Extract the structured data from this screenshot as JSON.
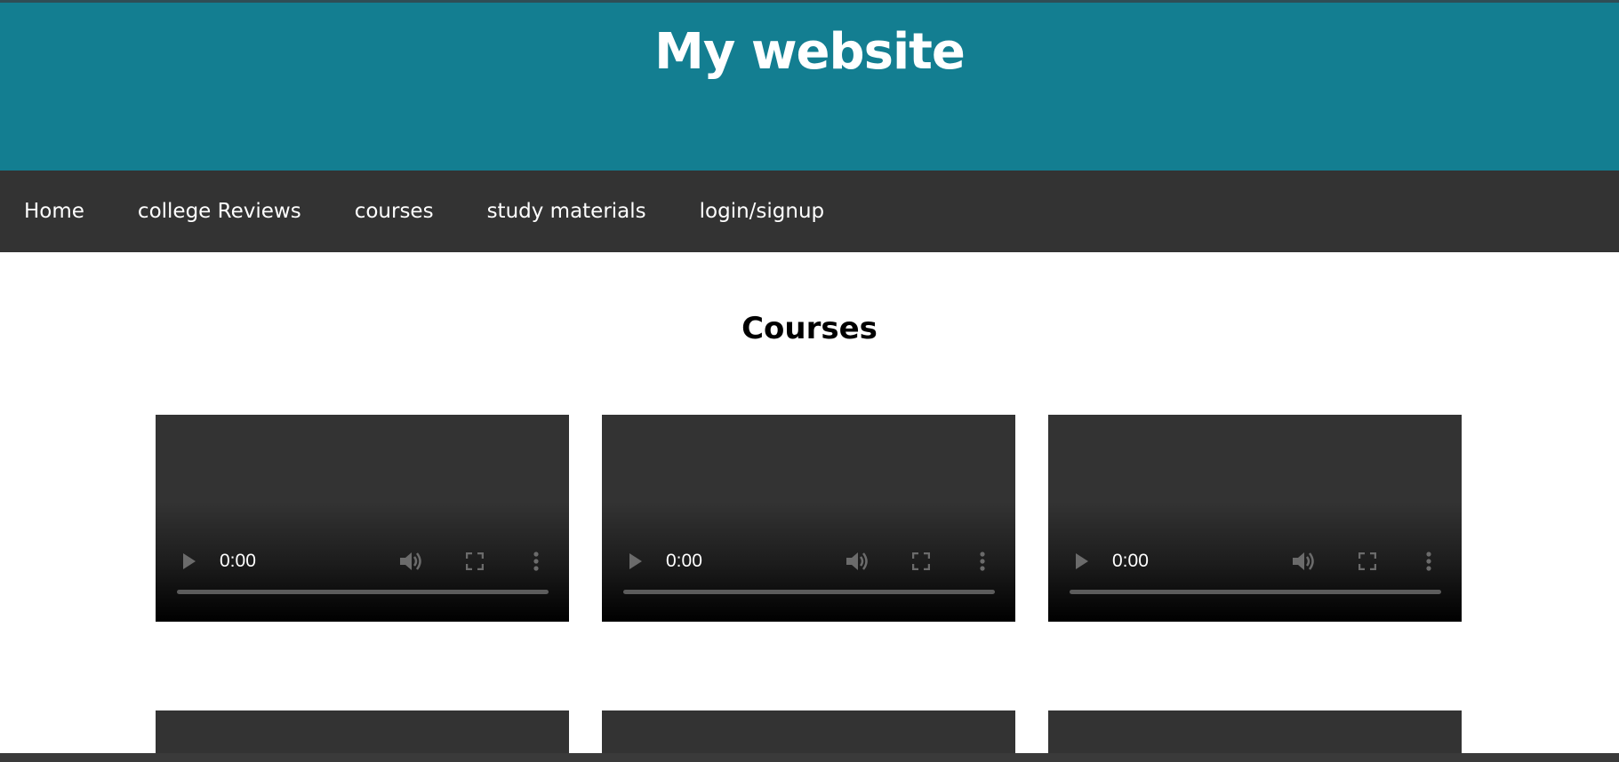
{
  "header": {
    "title": "My website"
  },
  "nav": {
    "items": [
      {
        "label": "Home"
      },
      {
        "label": "college Reviews"
      },
      {
        "label": "courses"
      },
      {
        "label": "study materials"
      },
      {
        "label": "login/signup"
      }
    ]
  },
  "main": {
    "heading": "Courses",
    "videos": [
      {
        "time": "0:00"
      },
      {
        "time": "0:00"
      },
      {
        "time": "0:00"
      }
    ]
  },
  "colors": {
    "header_bg": "#137e91",
    "nav_bg": "#333333",
    "page_bg": "#ffffff"
  },
  "icons": {
    "play": "play-icon",
    "volume": "volume-icon",
    "fullscreen": "fullscreen-icon",
    "more": "more-vert-icon"
  }
}
